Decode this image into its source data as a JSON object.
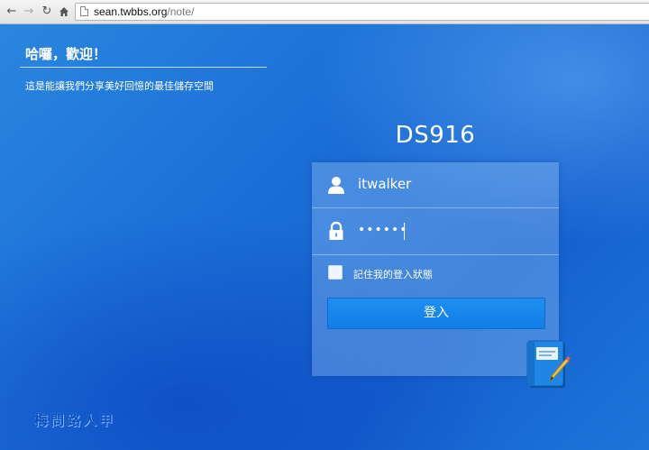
{
  "browser": {
    "url_domain": "sean.twbbs.org",
    "url_path": "/note/",
    "back_icon": "arrow-left",
    "forward_icon": "arrow-right",
    "reload_icon": "reload",
    "home_icon": "home"
  },
  "welcome": {
    "title": "哈囉，歡迎！",
    "subtitle": "這是能讓我們分享美好回憶的最佳儲存空間"
  },
  "login": {
    "server_name": "DS916",
    "username_value": "itwalker",
    "password_value": "••••••",
    "remember_label": "記住我的登入狀態",
    "remember_checked": false,
    "submit_label": "登入"
  },
  "watermark": {
    "text": "梅問路人甲"
  },
  "colors": {
    "background": "#1a6fd4",
    "button": "#1a88ec"
  },
  "icons": {
    "user": "user-icon",
    "lock": "lock-icon",
    "app_logo": "note-station-icon"
  }
}
